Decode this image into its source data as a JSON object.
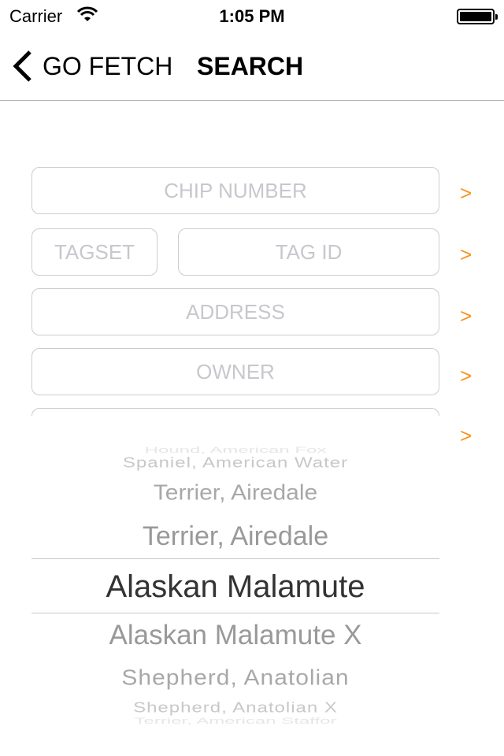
{
  "status_bar": {
    "carrier": "Carrier",
    "time": "1:05 PM",
    "wifi_icon": "wifi-icon",
    "battery_icon": "battery-icon",
    "battery_level": 1.0
  },
  "nav": {
    "back_label": "GO FETCH",
    "title": "SEARCH"
  },
  "fields": {
    "chip_number": {
      "placeholder": "CHIP NUMBER"
    },
    "tagset": {
      "placeholder": "TAGSET"
    },
    "tag_id": {
      "placeholder": "TAG ID"
    },
    "address": {
      "placeholder": "ADDRESS"
    },
    "owner": {
      "placeholder": "OWNER"
    },
    "breed": {
      "placeholder": ""
    }
  },
  "go_label": ">",
  "accent_color": "#f7941d",
  "picker": {
    "items": [
      "Hound, American Fox",
      "Spaniel, American Water",
      "Terrier, Airedale",
      "Terrier, Airedale",
      "Alaskan Malamute",
      "Alaskan Malamute X",
      "Shepherd, Anatolian",
      "Shepherd, Anatolian X",
      "Terrier, American Staffor"
    ],
    "selected": "Alaskan Malamute"
  }
}
